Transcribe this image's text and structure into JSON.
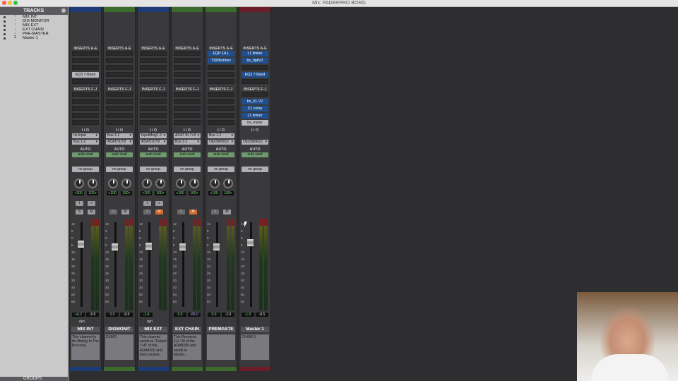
{
  "window": {
    "title": "Mix: FADERPRO BORG"
  },
  "tracks_panel": {
    "title": "TRACKS",
    "items": [
      {
        "label": "MIX INT"
      },
      {
        "label": "DIG MONITOR"
      },
      {
        "label": "MIX EXT"
      },
      {
        "label": "EXT CHAIN"
      },
      {
        "label": "PRE-MASTER"
      },
      {
        "label": "Master 1"
      }
    ],
    "groups_title": "GROUPS"
  },
  "labels": {
    "inserts_ae": "INSERTS A-E",
    "inserts_fj": "INSERTS F-J",
    "io": "I / O",
    "auto": "AUTO",
    "solo": "S",
    "mute": "M",
    "input": "I",
    "record": "●"
  },
  "strips": [
    {
      "name": "MIX INT",
      "color": "#1d3b78",
      "inserts_ae": [
        "",
        "",
        "",
        "EQ3 7-Band",
        ""
      ],
      "inserts_ae_style": [
        "",
        "",
        "",
        "gray",
        ""
      ],
      "inserts_fj": [
        "",
        "",
        "",
        "",
        ""
      ],
      "inserts_fj_style": [
        "",
        "",
        "",
        "",
        ""
      ],
      "io_in": "no input",
      "io_out": "Bus 1-2",
      "auto": "auto read",
      "group": "no group",
      "pan_l": "<100",
      "pan_r": "100>",
      "has_io_btns": true,
      "mute_on": false,
      "volume": "+6.2",
      "peak": "-8.8",
      "peak_neg": false,
      "dyn": "dyn",
      "comment": "This channel is for Mixing In The Box only."
    },
    {
      "name": "DIGMONIT",
      "color": "#3d6b2e",
      "inserts_ae": [
        "",
        "",
        "",
        "",
        ""
      ],
      "inserts_ae_style": [
        "",
        "",
        "",
        "",
        ""
      ],
      "inserts_fj": [
        "",
        "",
        "",
        "",
        ""
      ],
      "inserts_fj_style": [
        "",
        "",
        "",
        "",
        ""
      ],
      "io_in": "Bus 1-2",
      "io_out": "ADATOUT8",
      "auto": "auto read",
      "group": "no group",
      "pan_l": "<100",
      "pan_r": "100>",
      "has_io_btns": false,
      "mute_on": false,
      "volume": "0.0",
      "peak": "-8.8",
      "peak_neg": false,
      "dyn": "",
      "comment": "D1500"
    },
    {
      "name": "MIX EXT",
      "color": "#1d3b78",
      "inserts_ae": [
        "",
        "",
        "",
        "",
        ""
      ],
      "inserts_ae_style": [
        "",
        "",
        "",
        "",
        ""
      ],
      "inserts_fj": [
        "",
        "",
        "",
        "",
        ""
      ],
      "inserts_fj_style": [
        "",
        "",
        "",
        "",
        ""
      ],
      "io_in": "InputMsig7-2",
      "io_out": "ADATOUT8",
      "auto": "auto read",
      "group": "no group",
      "pan_l": "<100",
      "pan_r": "100>",
      "has_io_btns": true,
      "mute_on": true,
      "volume": "-1.4",
      "peak": "",
      "peak_neg": false,
      "dyn": "dyn",
      "comment": "This channel sends to \"Output 7+8\" of the ADA8200 and then receive..."
    },
    {
      "name": "EXT CHAIN",
      "color": "#3d6b2e",
      "inserts_ae": [
        "",
        "",
        "",
        "",
        ""
      ],
      "inserts_ae_style": [
        "",
        "",
        "",
        "",
        ""
      ],
      "inserts_fj": [
        "",
        "",
        "",
        "",
        ""
      ],
      "inserts_fj_style": [
        "",
        "",
        "",
        "",
        ""
      ],
      "io_in": "ADAT IN 7+8",
      "io_out": "Bus 1-2",
      "auto": "auto read",
      "group": "no group",
      "pan_l": "<100",
      "pan_r": "100>",
      "has_io_btns": false,
      "mute_on": true,
      "volume": "0.0",
      "peak": "-86.0",
      "peak_neg": true,
      "dyn": "",
      "comment": "This Receives CH 7/8 of the ADA8200 and sends to Master..."
    },
    {
      "name": "PREMASTE",
      "color": "#3d6b2e",
      "inserts_ae": [
        "EQP-1A L",
        "TDRKotlnkv",
        "",
        "",
        ""
      ],
      "inserts_ae_style": [
        "blue",
        "blue",
        "",
        "",
        ""
      ],
      "inserts_fj": [
        "",
        "",
        "",
        "",
        ""
      ],
      "inserts_fj_style": [
        "",
        "",
        "",
        "",
        ""
      ],
      "io_in": "Bus 1-2",
      "io_out": "OtptSWRI12",
      "auto": "auto read",
      "group": "no group",
      "pan_l": "<100",
      "pan_r": "100>",
      "has_io_btns": false,
      "mute_on": false,
      "volume": "0.0",
      "peak": "-3.9",
      "peak_neg": false,
      "dyn": "",
      "comment": ""
    },
    {
      "name": "Master 1",
      "color": "#6b1d2a",
      "inserts_ae": [
        "L1 limiter",
        "bx_dgtlV2",
        "",
        "EQ3 7-Band",
        ""
      ],
      "inserts_ae_style": [
        "blue",
        "blue",
        "",
        "blue",
        ""
      ],
      "inserts_fj": [
        "",
        "bx_XL V2",
        "C1 comp",
        "L1 limiter",
        "bx_meter"
      ],
      "inserts_fj_style": [
        "",
        "blue",
        "blue",
        "blue",
        "gray"
      ],
      "io_in": "",
      "io_out": "OtptSWRI12",
      "auto": "auto read",
      "group": "no group",
      "pan_l": "",
      "pan_r": "",
      "has_io_btns": false,
      "mute_on": false,
      "volume": "-1.0",
      "peak": "-8.5",
      "peak_neg": false,
      "dyn": "",
      "comment": "CHAIN 3"
    }
  ],
  "fader_scale": [
    "12",
    "5",
    "0",
    "5",
    "10",
    "15",
    "20",
    "25",
    "30",
    "40",
    "50",
    "60"
  ]
}
